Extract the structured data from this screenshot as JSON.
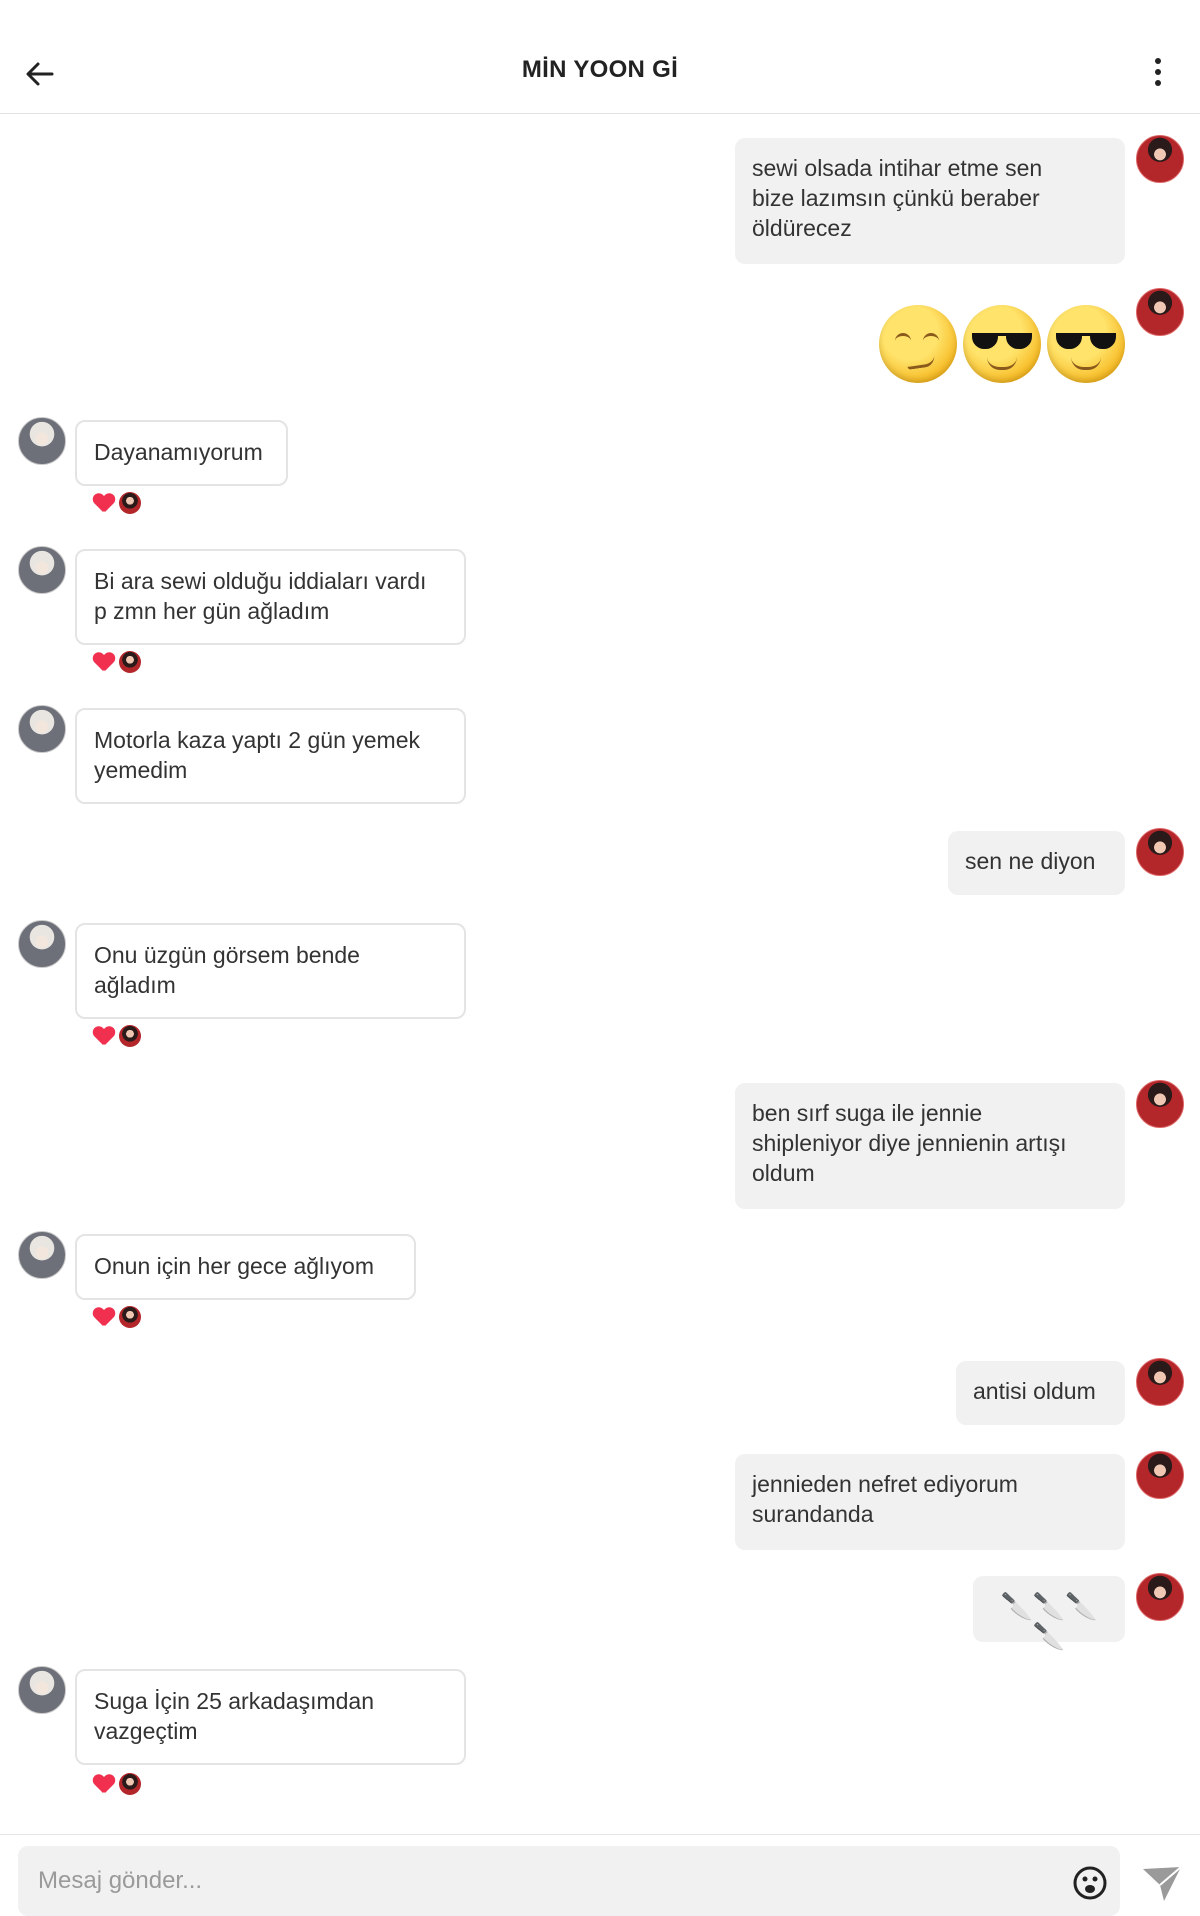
{
  "header": {
    "title": "MİN YOON Gİ",
    "back_icon": "arrow-left-icon",
    "more_icon": "vertical-dots-icon"
  },
  "messages": [
    {
      "side": "out",
      "text": "sewi olsada intihar etme sen\nbize lazımsın çünkü beraber\nöldürecez"
    },
    {
      "side": "out",
      "emojis": [
        "smirk-emoji",
        "sunglasses-emoji",
        "sunglasses-emoji"
      ]
    },
    {
      "side": "in",
      "text": "Dayanamıyorum",
      "reaction": "heart"
    },
    {
      "side": "in",
      "text": "Bi ara sewi olduğu iddiaları vardı\np zmn her gün ağladım",
      "reaction": "heart"
    },
    {
      "side": "in",
      "text": "Motorla kaza yaptı 2 gün yemek\nyemedim"
    },
    {
      "side": "out",
      "text": "sen ne diyon"
    },
    {
      "side": "in",
      "text": "Onu üzgün görsem bende\nağladım",
      "reaction": "heart"
    },
    {
      "side": "out",
      "text": "ben sırf suga ile jennie\nshipleniyor diye jennienin artışı\noldum"
    },
    {
      "side": "in",
      "text": "Onun için her gece  ağlıyom",
      "reaction": "heart"
    },
    {
      "side": "out",
      "text": "antisi oldum"
    },
    {
      "side": "out",
      "text": "jennieden nefret ediyorum\nsurandanda"
    },
    {
      "side": "out",
      "text": "🔪🔪🔪🔪"
    },
    {
      "side": "in",
      "text": "Suga İçin 25 arkadaşımdan\nvazgeçtim",
      "reaction": "heart"
    }
  ],
  "composer": {
    "placeholder": "Mesaj gönder...",
    "emoji_icon": "smiley-icon",
    "send_icon": "paper-plane-icon"
  },
  "colors": {
    "outgoing_bubble": "#f1f1f1",
    "incoming_border": "#e4e4e4",
    "reaction_heart": "#f0304e"
  }
}
